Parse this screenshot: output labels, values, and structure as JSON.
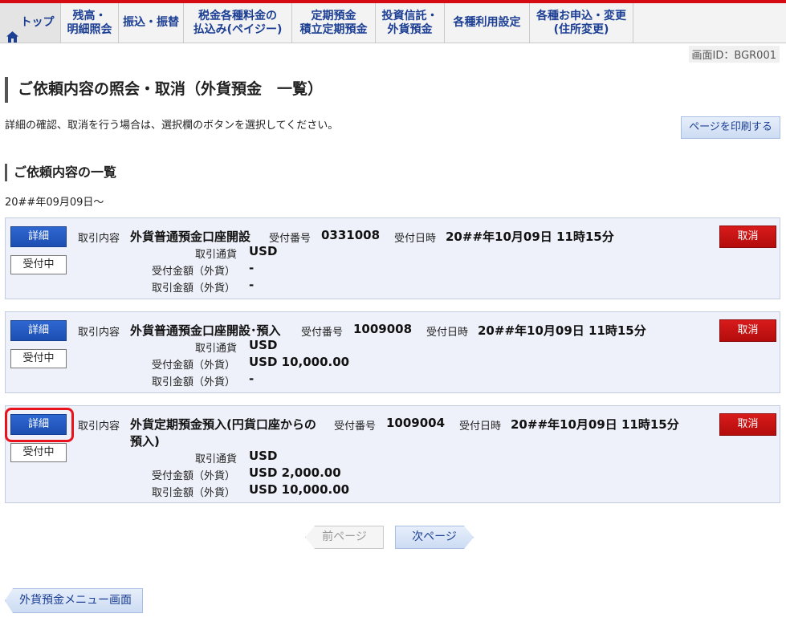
{
  "nav": {
    "top": "トップ",
    "items": [
      "残高・\n明細照会",
      "振込・振替",
      "税金各種料金の\n払込み(ペイジー)",
      "定期預金\n積立定期預金",
      "投資信託・\n外貨預金",
      "各種利用設定",
      "各種お申込・変更\n(住所変更)"
    ]
  },
  "screen_id": "画面ID：BGR001",
  "page_title": "ご依頼内容の照会・取消（外貨預金　一覧）",
  "description": "詳細の確認、取消を行う場合は、選択欄のボタンを選択してください。",
  "print_button": "ページを印刷する",
  "section_title": "ご依頼内容の一覧",
  "date_from": "20##年09月09日～",
  "labels": {
    "detail": "詳細",
    "status": "受付中",
    "cancel": "取消",
    "transaction": "取引内容",
    "receipt_no": "受付番号",
    "receipt_date": "受付日時",
    "currency": "取引通貨",
    "recv_amount": "受付金額（外貨）",
    "trade_amount": "取引金額（外貨）"
  },
  "records": [
    {
      "transaction": "外貨普通預金口座開設",
      "receipt_no": "0331008",
      "receipt_date": "20##年10月09日 11時15分",
      "currency": "USD",
      "recv_amount": "-",
      "trade_amount": "-"
    },
    {
      "transaction": "外貨普通預金口座開設･預入",
      "receipt_no": "1009008",
      "receipt_date": "20##年10月09日 11時15分",
      "currency": "USD",
      "recv_amount": "USD 10,000.00",
      "trade_amount": "-"
    },
    {
      "transaction_line1": "外貨定期預金預入(円貨口座からの",
      "transaction_line2": "預入)",
      "receipt_no": "1009004",
      "receipt_date": "20##年10月09日 11時15分",
      "currency": "USD",
      "recv_amount": "USD 2,000.00",
      "trade_amount": "USD 10,000.00"
    }
  ],
  "pager": {
    "prev": "前ページ",
    "next": "次ページ"
  },
  "back_button": "外貨預金メニュー画面へ",
  "colors": {
    "accent_red": "#d50a12",
    "nav_text": "#1c3f94",
    "detail_blue": "#1d4fb2",
    "cancel_red": "#c41212"
  }
}
